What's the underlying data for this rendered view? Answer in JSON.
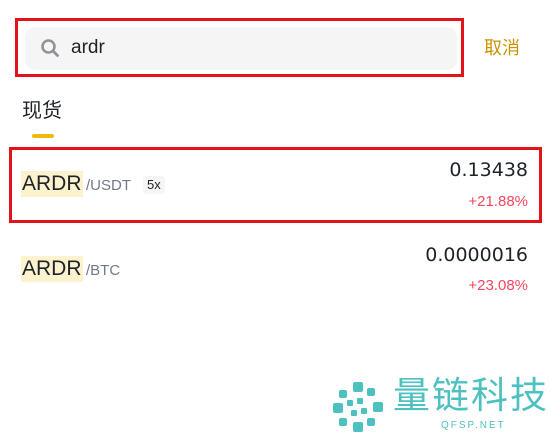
{
  "search": {
    "value": "ardr",
    "cancel_label": "取消",
    "icon": "search-icon"
  },
  "tabs": [
    {
      "label": "现货",
      "active": true
    }
  ],
  "results": [
    {
      "base": "ARDR",
      "quote": "/USDT",
      "leverage": "5x",
      "price": "0.13438",
      "change": "+21.88%"
    },
    {
      "base": "ARDR",
      "quote": "/BTC",
      "price": "0.0000016",
      "change": "+23.08%"
    }
  ],
  "watermark": {
    "name": "量链科技",
    "url": "QFSP.NET"
  },
  "colors": {
    "accent": "#f0b90b",
    "cancel": "#c99400",
    "positive_change": "#f6465d",
    "highlight_outline": "#e3131b",
    "watermark": "#2fb7b4"
  }
}
